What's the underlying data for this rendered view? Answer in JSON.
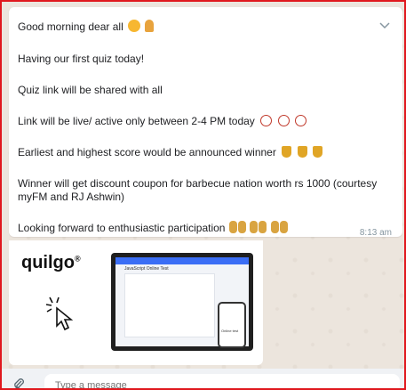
{
  "message": {
    "lines": [
      "Good morning dear all",
      "Having our first quiz today!",
      "Quiz link will be shared with all",
      "Link will be live/ active only between 2-4 PM today",
      "Earliest and highest score would be announced winner",
      "Winner will get discount coupon for barbecue nation worth rs 1000 (courtesy myFM and RJ Ashwin)",
      "Looking forward to enthusiastic participation"
    ],
    "time": "8:13 am"
  },
  "media": {
    "logo": "quilgo",
    "logo_mark": "®",
    "screen_title": "JavaScript Online Test",
    "phone_title": "Online test"
  },
  "composer": {
    "placeholder": "Type a message"
  },
  "colors": {
    "frame_border": "#e0181e",
    "bubble_bg": "#ffffff",
    "chat_bg": "#ece5dd"
  },
  "icons": {
    "chevron": "chevron-down-icon",
    "attach": "paperclip-icon"
  }
}
